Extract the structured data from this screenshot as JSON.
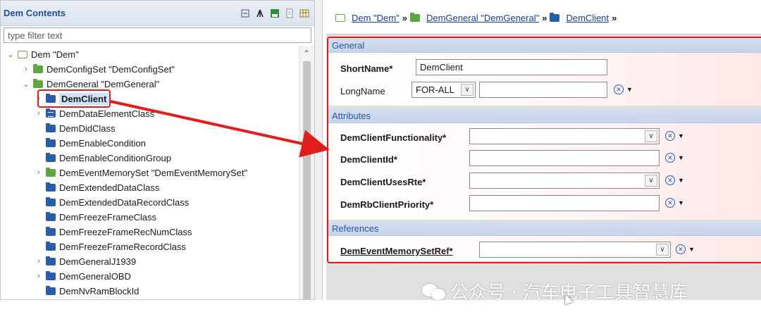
{
  "left_panel": {
    "title": "Dem Contents",
    "filter_placeholder": "type filter text",
    "tree": [
      {
        "label": "Dem \"Dem\"",
        "twisty": "open",
        "icon": "plain"
      },
      {
        "label": "DemConfigSet \"DemConfigSet\"",
        "twisty": "closed",
        "icon": "green"
      },
      {
        "label": "DemGeneral \"DemGeneral\"",
        "twisty": "open",
        "icon": "green"
      },
      {
        "label": "DemClient",
        "twisty": "closed",
        "icon": "blue",
        "selected": true
      },
      {
        "label": "DemDataElementClass",
        "twisty": "closed",
        "icon": "data"
      },
      {
        "label": "DemDidClass",
        "twisty": "none",
        "icon": "blue"
      },
      {
        "label": "DemEnableCondition",
        "twisty": "none",
        "icon": "blue"
      },
      {
        "label": "DemEnableConditionGroup",
        "twisty": "none",
        "icon": "blue"
      },
      {
        "label": "DemEventMemorySet \"DemEventMemorySet\"",
        "twisty": "closed",
        "icon": "green"
      },
      {
        "label": "DemExtendedDataClass",
        "twisty": "none",
        "icon": "blue"
      },
      {
        "label": "DemExtendedDataRecordClass",
        "twisty": "none",
        "icon": "blue"
      },
      {
        "label": "DemFreezeFrameClass",
        "twisty": "none",
        "icon": "blue"
      },
      {
        "label": "DemFreezeFrameRecNumClass",
        "twisty": "none",
        "icon": "blue"
      },
      {
        "label": "DemFreezeFrameRecordClass",
        "twisty": "none",
        "icon": "blue"
      },
      {
        "label": "DemGeneralJ1939",
        "twisty": "closed",
        "icon": "blue"
      },
      {
        "label": "DemGeneralOBD",
        "twisty": "closed",
        "icon": "blue"
      },
      {
        "label": "DemNvRamBlockId",
        "twisty": "none",
        "icon": "blue"
      }
    ]
  },
  "breadcrumb": {
    "root": "Dem \"Dem\"",
    "general": "DemGeneral \"DemGeneral\"",
    "client": "DemClient",
    "separator": "»"
  },
  "general": {
    "header": "General",
    "shortname_label": "ShortName*",
    "shortname_value": "DemClient",
    "longname_label": "LongName",
    "longname_lang": "FOR-ALL",
    "longname_value": ""
  },
  "attributes": {
    "header": "Attributes",
    "functionality_label": "DemClientFunctionality*",
    "id_label": "DemClientId*",
    "uses_rte_label": "DemClientUsesRte*",
    "priority_label": "DemRbClientPriority*"
  },
  "references": {
    "header": "References",
    "event_memory_set_ref_label": "DemEventMemorySetRef*"
  },
  "watermark": "公众号 · 汽车电子工具智慧库",
  "colors": {
    "highlight": "#e01d1d",
    "link": "#1d3c8f",
    "section_header": "#2a55a0"
  }
}
